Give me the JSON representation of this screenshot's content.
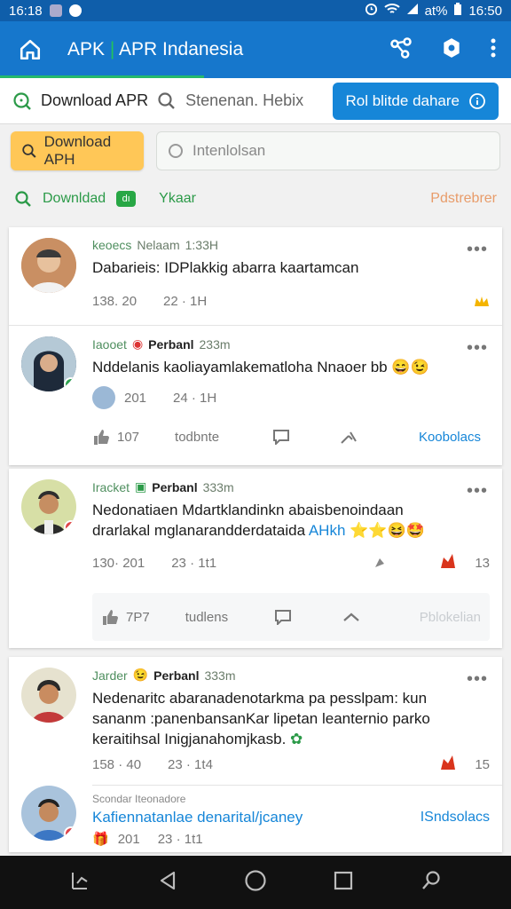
{
  "status_bar": {
    "time_left": "16:18",
    "battery": "at%",
    "time_right": "16:50"
  },
  "app_bar": {
    "title_part1": "APK",
    "title_sep": "|",
    "title_part2": "APR Indanesia"
  },
  "search_row": {
    "download_label": "Download APR",
    "secondary_label": "Stenenan. Hebix",
    "button_label": "Rol blitde dahare"
  },
  "download_row": {
    "button_label": "Download APH",
    "field_placeholder": "Intenlolsan"
  },
  "filter_row": {
    "download_label": "Downldad",
    "badge": "dı",
    "ykaar": "Ykaar",
    "right_label": "Pdstrebrer"
  },
  "posts": [
    {
      "tag": "keoecs",
      "name": "Nelaam",
      "time": "1:33H",
      "text": "Dabarieis: IDPlakkig abarra kaartamcan",
      "stat1": "138. 20",
      "stat2": "22 · 1H"
    },
    {
      "tag": "Iaooet",
      "name": "Perbanl",
      "time": "233m",
      "text": "Nddelanis kaoliayamlakematloha Nnaoer bb",
      "stat1": "201",
      "stat2": "24 · 1H",
      "act_likes": "107",
      "act_label": "todbnte",
      "act_link": "Koobolacs"
    },
    {
      "tag": "Iracket",
      "name": "Perbanl",
      "time": "333m",
      "text1": "Nedonatiaen Mdartklandinkn abaisbenoindaan",
      "text2": "drarlakal mglanarandderdataida",
      "text2_link": "AHkh",
      "stat1": "130· 201",
      "stat2": "23 · 1t1",
      "count": "13",
      "act_likes": "7P7",
      "act_label": "tudlens",
      "act_link": "Pblokelian"
    },
    {
      "tag": "Jarder",
      "name": "Perbanl",
      "time": "333m",
      "text1": "Nedenaritc abaranadenotarkma pa pesslpam: kun",
      "text2": "sananm :panenbansanKar lipetan leanternio parko",
      "text3": "keraitihsal Inigjanahomjkasb.",
      "stat1": "158 · 40",
      "stat2": "23 · 1t4",
      "count": "15"
    },
    {
      "tag": "Scondar Iteonadore",
      "link": "Kafiennatanlae denarital/jcaney",
      "right_link": "ISndsolacs",
      "stat1": "201",
      "stat2": "23 · 1t1"
    }
  ],
  "colors": {
    "app_bar": "#1677cc",
    "accent_green": "#23c35b",
    "link_blue": "#1686d8",
    "yellow_button": "#ffc757"
  },
  "icons": [
    "home-icon",
    "sync-icon",
    "settings-icon",
    "more-vert-icon",
    "search-icon",
    "info-icon",
    "like-icon",
    "comment-icon",
    "share-icon",
    "star-icon"
  ]
}
